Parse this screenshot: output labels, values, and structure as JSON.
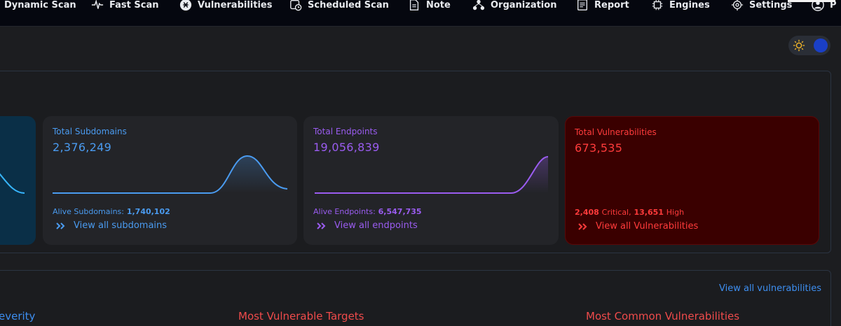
{
  "nav": {
    "items": [
      {
        "label": "Dynamic Scan",
        "icon": "radar-icon"
      },
      {
        "label": "Fast Scan",
        "icon": "pulse-icon"
      },
      {
        "label": "Vulnerabilities",
        "icon": "bug-icon"
      },
      {
        "label": "Scheduled Scan",
        "icon": "calendar-clock-icon"
      },
      {
        "label": "Note",
        "icon": "note-icon"
      },
      {
        "label": "Organization",
        "icon": "organization-icon"
      },
      {
        "label": "Report",
        "icon": "report-icon"
      },
      {
        "label": "Engines",
        "icon": "chip-icon"
      },
      {
        "label": "Settings",
        "icon": "gear-icon"
      },
      {
        "label": "P",
        "icon": "user-icon"
      }
    ]
  },
  "theme_toggle": {
    "mode": "dark",
    "icons": [
      "sun-icon",
      "toggle-knob"
    ]
  },
  "stats": {
    "subdomains": {
      "title": "Total Subdomains",
      "value": "2,376,249",
      "alive_label": "Alive Subdomains:",
      "alive_value": "1,740,102",
      "link": "View all subdomains",
      "color": "#4a9bf0"
    },
    "endpoints": {
      "title": "Total Endpoints",
      "value": "19,056,839",
      "alive_label": "Alive Endpoints:",
      "alive_value": "6,547,735",
      "link": "View all endpoints",
      "color": "#9a5cf0"
    },
    "vulnerabilities": {
      "title": "Total Vulnerabilities",
      "value": "673,535",
      "critical_value": "2,408",
      "critical_label": "Critical,",
      "high_value": "13,651",
      "high_label": "High",
      "link": "View all Vulnerabilities",
      "color": "#ff3b3b"
    }
  },
  "bottom": {
    "view_all": "View all vulnerabilities",
    "sections": [
      "everity",
      "Most Vulnerable Targets",
      "Most Common Vulnerabilities"
    ]
  }
}
